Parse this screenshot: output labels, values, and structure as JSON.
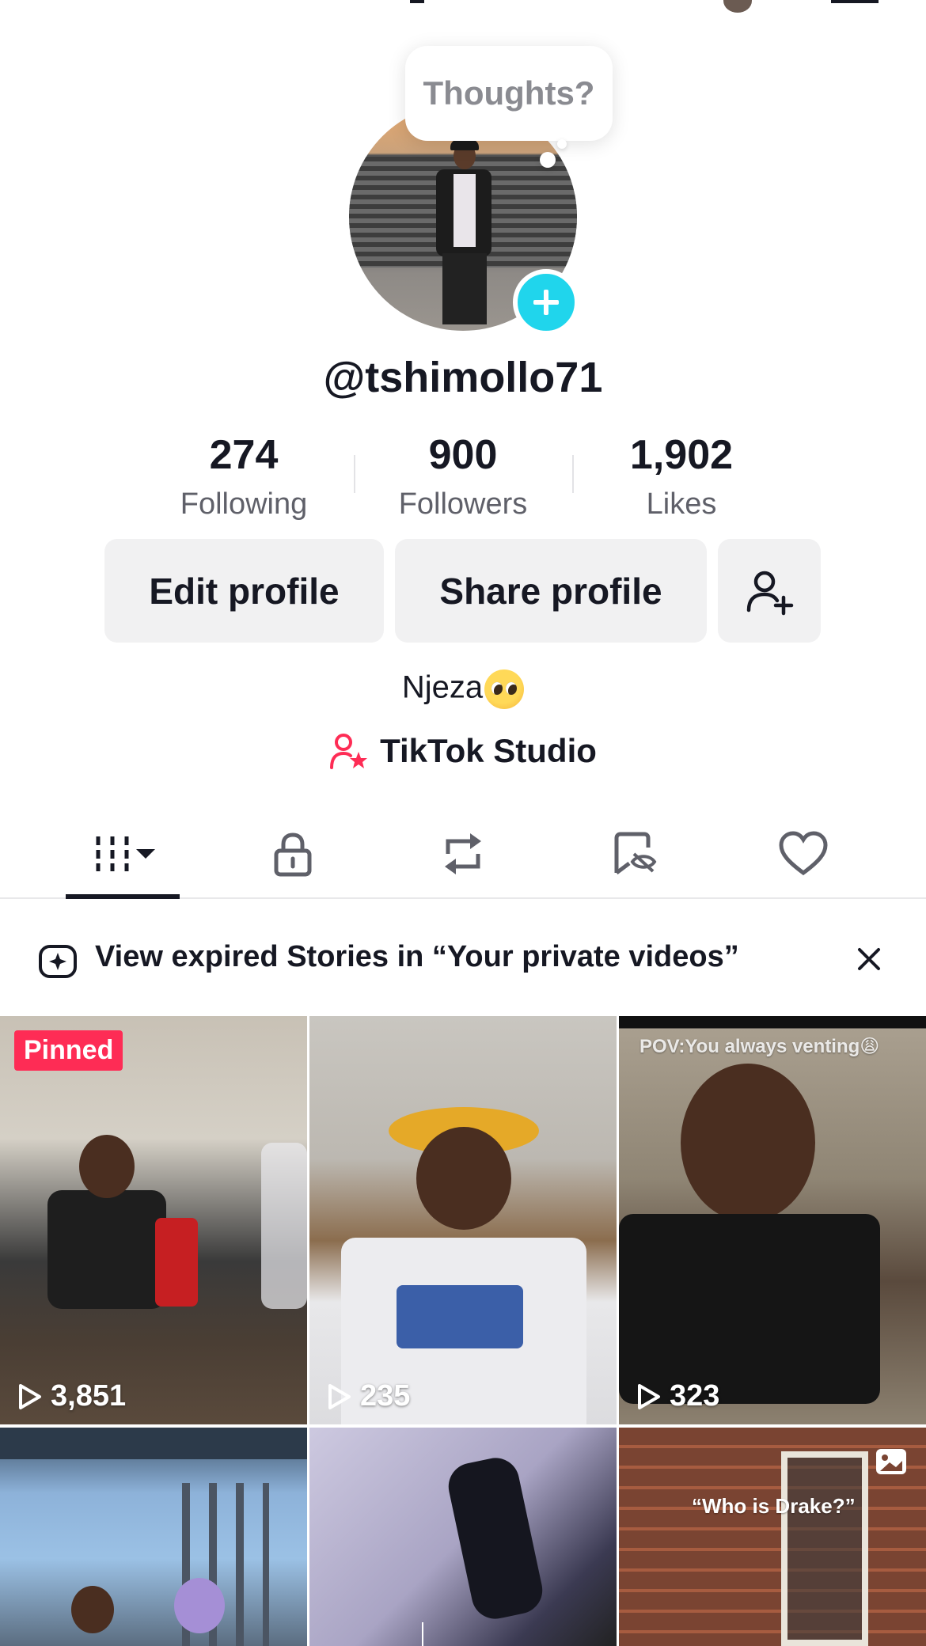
{
  "profile": {
    "thought_bubble": "Thoughts?",
    "username": "@tshimollo71",
    "bio": "Njeza"
  },
  "stats": [
    {
      "value": "274",
      "label": "Following"
    },
    {
      "value": "900",
      "label": "Followers"
    },
    {
      "value": "1,902",
      "label": "Likes"
    }
  ],
  "actions": {
    "edit_label": "Edit profile",
    "share_label": "Share profile"
  },
  "studio": {
    "label": "TikTok Studio"
  },
  "tabs": [
    {
      "icon": "videos-grid-icon",
      "active": true
    },
    {
      "icon": "lock-icon",
      "active": false
    },
    {
      "icon": "repost-icon",
      "active": false
    },
    {
      "icon": "bookmark-hidden-icon",
      "active": false
    },
    {
      "icon": "heart-icon",
      "active": false
    }
  ],
  "banner": {
    "text": "View expired Stories in “Your private videos”"
  },
  "videos": [
    {
      "views": "3,851",
      "pinned_label": "Pinned"
    },
    {
      "views": "235"
    },
    {
      "views": "323",
      "overlay": "POV:You always venting😩"
    },
    {},
    {},
    {
      "overlay": "“Who is Drake?”"
    }
  ],
  "colors": {
    "accent_cyan": "#20d5ec",
    "accent_pink": "#fe2c55",
    "text_primary": "#161823",
    "text_secondary": "#5f6069",
    "button_bg": "#f1f1f2"
  }
}
